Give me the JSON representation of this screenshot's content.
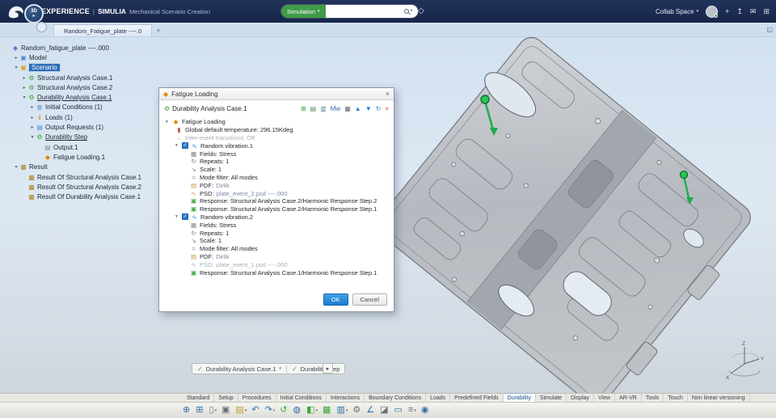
{
  "ui": {
    "caret_down": "▾",
    "close": "×",
    "check": "✓",
    "play": "▸",
    "expand": "◱",
    "tag": "◇",
    "mag_plus": "+"
  },
  "topbar": {
    "brand": "3DEXPERIENCE",
    "sep": "|",
    "product": "SIMULIA",
    "app_title": "Mechanical Scenario Creation",
    "search": {
      "scope": "Simulation"
    },
    "collab": {
      "label": "Collab Space"
    },
    "badge": {
      "line1": "3D",
      "line2": "▸"
    },
    "actions": [
      {
        "name": "add-icon",
        "glyph": "+"
      },
      {
        "name": "share-icon",
        "glyph": "↥"
      },
      {
        "name": "notifications-icon",
        "glyph": "✉"
      },
      {
        "name": "apps-grid-icon",
        "glyph": "⊞"
      }
    ]
  },
  "doc_tab": {
    "label": "Random_Fatigue_plate ----.0",
    "new_tab": "+"
  },
  "tree": {
    "items": [
      {
        "exp": "",
        "icon": "◆",
        "ic": "#8a6ad0",
        "label": "Random_fatigue_plate ----.000",
        "cls": "lv0"
      },
      {
        "exp": "▸",
        "icon": "▣",
        "ic": "#4a90d9",
        "label": "Model",
        "cls": "lv1"
      },
      {
        "exp": "▾",
        "icon": "▣",
        "ic": "#e0a030",
        "label": "Scenario",
        "cls": "lv1 sel"
      },
      {
        "exp": "▸",
        "icon": "⚙",
        "ic": "#3aa53a",
        "label": "Structural Analysis Case.1",
        "cls": "lv2"
      },
      {
        "exp": "▸",
        "icon": "⚙",
        "ic": "#3aa53a",
        "label": "Structural Analysis Case.2",
        "cls": "lv2"
      },
      {
        "exp": "▾",
        "icon": "⚙",
        "ic": "#3aa53a",
        "label": "Durability Analysis Case.1",
        "cls": "lv2 ul"
      },
      {
        "exp": "▸",
        "icon": "◍",
        "ic": "#4a90d9",
        "label": "Initial Conditions (1)",
        "cls": "lv3"
      },
      {
        "exp": "▸",
        "icon": "⇓",
        "ic": "#cc8a00",
        "label": "Loads (1)",
        "cls": "lv3"
      },
      {
        "exp": "▸",
        "icon": "▤",
        "ic": "#4a90d9",
        "label": "Output Requests (1)",
        "cls": "lv3"
      },
      {
        "exp": "▾",
        "icon": "⚙",
        "ic": "#3aa53a",
        "label": "Durability Step",
        "cls": "lv3 ul"
      },
      {
        "exp": "",
        "icon": "▤",
        "ic": "#8a8f94",
        "label": "Output.1",
        "cls": "lv4"
      },
      {
        "exp": "",
        "icon": "◆",
        "ic": "#e08a00",
        "label": "Fatigue Loading.1",
        "cls": "lv4"
      },
      {
        "exp": "▾",
        "icon": "▦",
        "ic": "#b0892a",
        "label": "Result",
        "cls": "lv1"
      },
      {
        "exp": "",
        "icon": "▦",
        "ic": "#b0892a",
        "label": "Result Of Structural Analysis Case.1",
        "cls": "lv2"
      },
      {
        "exp": "",
        "icon": "▦",
        "ic": "#b0892a",
        "label": "Result Of Structural Analysis Case.2",
        "cls": "lv2"
      },
      {
        "exp": "",
        "icon": "▦",
        "ic": "#b0892a",
        "label": "Result Of Durability Analysis Case.1",
        "cls": "lv2"
      }
    ]
  },
  "dialog": {
    "title": "Fatigue Loading",
    "icon": "◆",
    "case": {
      "label": "Durability Analysis Case.1",
      "icon": "⚙"
    },
    "tools": [
      {
        "name": "add-event-icon",
        "glyph": "⊞",
        "ic": "#3aa53a"
      },
      {
        "name": "import-event-icon",
        "glyph": "▤",
        "ic": "#5a8f5a"
      },
      {
        "name": "export-event-icon",
        "glyph": "▥",
        "ic": "#5a7f9f"
      },
      {
        "name": "modal-weight-icon",
        "glyph": "Mw",
        "ic": "#2d6da8"
      },
      {
        "name": "table-icon",
        "glyph": "▦",
        "ic": "#6a6f74"
      },
      {
        "name": "move-up-icon",
        "glyph": "▲",
        "ic": "#2d7dd2"
      },
      {
        "name": "move-down-icon",
        "glyph": "▼",
        "ic": "#2d7dd2"
      },
      {
        "name": "refresh-icon",
        "glyph": "↻",
        "ic": "#2d7dd2"
      },
      {
        "name": "remove-icon",
        "glyph": "×",
        "ic": "#d23a3a"
      }
    ],
    "rows": [
      {
        "cls": "ind0 has-exp",
        "exp": "▾",
        "icon": "◆",
        "ic": "#e08a00",
        "t": "Fatigue Loading",
        "v": ""
      },
      {
        "cls": "ind1",
        "exp": "",
        "icon": "▮",
        "ic": "#c85050",
        "t": "Global default temperature: 296.15Kdeg",
        "v": ""
      },
      {
        "cls": "ind1 gray",
        "exp": "",
        "icon": "↔",
        "ic": "#9aa0a6",
        "t": "Inter-event transitions: Off",
        "v": ""
      },
      {
        "cls": "ind1 has-exp has-cb",
        "exp": "▾",
        "icon": "∿",
        "ic": "#2d7dd2",
        "t": "Random vibration.1",
        "v": ""
      },
      {
        "cls": "ind2",
        "exp": "",
        "icon": "▦",
        "ic": "#7a8087",
        "t": "Fields: Stress",
        "v": ""
      },
      {
        "cls": "ind2",
        "exp": "",
        "icon": "↻",
        "ic": "#7a8087",
        "t": "Repeats: 1",
        "v": ""
      },
      {
        "cls": "ind2",
        "exp": "",
        "icon": "↘",
        "ic": "#7a8087",
        "t": "Scale: 1",
        "v": ""
      },
      {
        "cls": "ind2",
        "exp": "",
        "icon": "≈",
        "ic": "#7a8087",
        "t": "Mode filter: All modes",
        "v": ""
      },
      {
        "cls": "ind2",
        "exp": "",
        "icon": "▤",
        "ic": "#c49a3a",
        "t": "PDF:",
        "v": "Dirlik"
      },
      {
        "cls": "ind2",
        "exp": "",
        "icon": "∿",
        "ic": "#c49a3a",
        "t": "PSD:",
        "v": "plate_event_2.psd ----.000"
      },
      {
        "cls": "ind2",
        "exp": "",
        "icon": "▣",
        "ic": "#3aa53a",
        "t": "Response: Structural Analysis Case.2/Harmonic Response Step.2",
        "v": ""
      },
      {
        "cls": "ind2",
        "exp": "",
        "icon": "▣",
        "ic": "#3aa53a",
        "t": "Response: Structural Analysis Case.2/Harmonic Response Step.1",
        "v": ""
      },
      {
        "cls": "ind1 has-exp has-cb",
        "exp": "▾",
        "icon": "∿",
        "ic": "#2d7dd2",
        "t": "Random vibration.2",
        "v": ""
      },
      {
        "cls": "ind2",
        "exp": "",
        "icon": "▦",
        "ic": "#7a8087",
        "t": "Fields: Stress",
        "v": ""
      },
      {
        "cls": "ind2",
        "exp": "",
        "icon": "↻",
        "ic": "#7a8087",
        "t": "Repeats: 1",
        "v": ""
      },
      {
        "cls": "ind2",
        "exp": "",
        "icon": "↘",
        "ic": "#7a8087",
        "t": "Scale: 1",
        "v": ""
      },
      {
        "cls": "ind2",
        "exp": "",
        "icon": "≈",
        "ic": "#7a8087",
        "t": "Mode filter: All modes",
        "v": ""
      },
      {
        "cls": "ind2",
        "exp": "",
        "icon": "▤",
        "ic": "#c49a3a",
        "t": "PDF:",
        "v": "Dirlik"
      },
      {
        "cls": "ind2 gray",
        "exp": "",
        "icon": "∿",
        "ic": "#c49a3a",
        "t": "PSD:",
        "v": "plate_event_1.psd ----.000"
      },
      {
        "cls": "ind2",
        "exp": "",
        "icon": "▣",
        "ic": "#3aa53a",
        "t": "Response: Structural Analysis Case.1/Harmonic Response Step.1",
        "v": ""
      }
    ],
    "ok": "OK",
    "cancel": "Cancel"
  },
  "status": {
    "check": "✓",
    "case": "Durability Analysis Case.1",
    "caret": "▾",
    "step": "Durability Step",
    "more": "▸"
  },
  "compass": {
    "z": "Z",
    "y": "Y",
    "x": "X"
  },
  "ribbon": {
    "tabs": [
      {
        "label": "Standard",
        "cls": ""
      },
      {
        "label": "Setup",
        "cls": ""
      },
      {
        "label": "Procedures",
        "cls": ""
      },
      {
        "label": "Initial Conditions",
        "cls": ""
      },
      {
        "label": "Interactions",
        "cls": ""
      },
      {
        "label": "Boundary Conditions",
        "cls": ""
      },
      {
        "label": "Loads",
        "cls": ""
      },
      {
        "label": "Predefined Fields",
        "cls": ""
      },
      {
        "label": "Durability",
        "cls": "active"
      },
      {
        "label": "Simulate",
        "cls": ""
      },
      {
        "label": "Display",
        "cls": ""
      },
      {
        "label": "View",
        "cls": ""
      },
      {
        "label": "AR-VR",
        "cls": ""
      },
      {
        "label": "Tools",
        "cls": ""
      },
      {
        "label": "Touch",
        "cls": ""
      },
      {
        "label": "Non linear versioning",
        "cls": ""
      }
    ]
  },
  "toolbar": {
    "icons": [
      {
        "name": "zoom-icon",
        "glyph": "⊕",
        "ic": "#2d6da8",
        "caret": ""
      },
      {
        "name": "fit-all-icon",
        "glyph": "⊞",
        "ic": "#2d6da8",
        "caret": ""
      },
      {
        "name": "clipboard-icon",
        "glyph": "▯",
        "ic": "#6a6f74",
        "caret": "▾"
      },
      {
        "name": "copy-icon",
        "glyph": "▣",
        "ic": "#6a6f74",
        "caret": ""
      },
      {
        "name": "catalog-icon",
        "glyph": "▤",
        "ic": "#c49a3a",
        "caret": "▾"
      },
      {
        "name": "undo-icon",
        "glyph": "↶",
        "ic": "#2d6da8",
        "caret": ""
      },
      {
        "name": "redo-icon",
        "glyph": "↷",
        "ic": "#2d6da8",
        "caret": "▾"
      },
      {
        "name": "update-icon",
        "glyph": "↺",
        "ic": "#3aa53a",
        "caret": ""
      },
      {
        "name": "world-icon",
        "glyph": "◍",
        "ic": "#2d6da8",
        "caret": ""
      },
      {
        "name": "model-views-icon",
        "glyph": "◧",
        "ic": "#3aa53a",
        "caret": "▾"
      },
      {
        "name": "mesh-icon",
        "glyph": "▦",
        "ic": "#3aa53a",
        "caret": ""
      },
      {
        "name": "group-icon",
        "glyph": "▥",
        "ic": "#2d6da8",
        "caret": "▾"
      },
      {
        "name": "settings-gear-icon",
        "glyph": "⚙",
        "ic": "#6a6f74",
        "caret": ""
      },
      {
        "name": "measure-icon",
        "glyph": "∠",
        "ic": "#2d6da8",
        "caret": ""
      },
      {
        "name": "section-icon",
        "glyph": "◪",
        "ic": "#6a6f74",
        "caret": ""
      },
      {
        "name": "annotation-icon",
        "glyph": "▭",
        "ic": "#2d6da8",
        "caret": ""
      },
      {
        "name": "layers-icon",
        "glyph": "≡",
        "ic": "#6a6f74",
        "caret": "▾"
      },
      {
        "name": "info-icon",
        "glyph": "◉",
        "ic": "#2d6da8",
        "caret": ""
      }
    ]
  }
}
